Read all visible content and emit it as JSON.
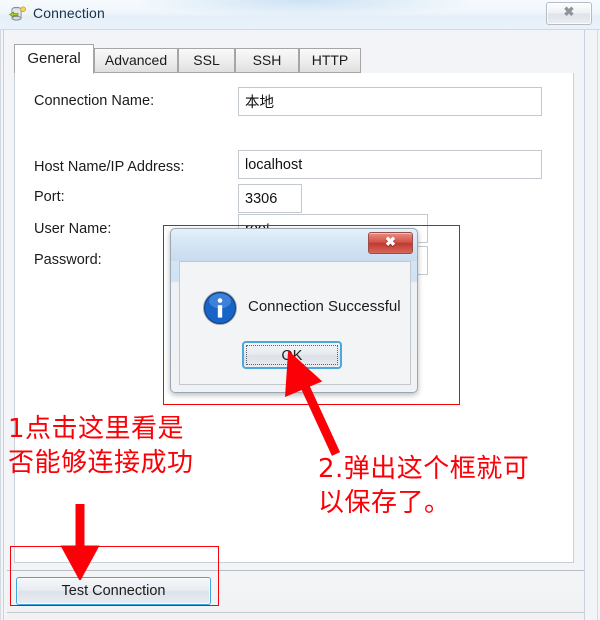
{
  "window": {
    "title": "Connection",
    "icon": "database-connection-icon",
    "close_label": "✕"
  },
  "tabs": [
    {
      "label": "General",
      "active": true
    },
    {
      "label": "Advanced",
      "active": false
    },
    {
      "label": "SSL",
      "active": false
    },
    {
      "label": "SSH",
      "active": false
    },
    {
      "label": "HTTP",
      "active": false
    }
  ],
  "form": {
    "fields": [
      {
        "label": "Connection Name:",
        "value": "本地",
        "name": "connection-name"
      },
      {
        "label": "Host Name/IP Address:",
        "value": "localhost",
        "name": "host-name"
      },
      {
        "label": "Port:",
        "value": "3306",
        "name": "port"
      },
      {
        "label": "User Name:",
        "value": "root",
        "name": "user-name"
      },
      {
        "label": "Password:",
        "value": "",
        "name": "password"
      }
    ]
  },
  "footer": {
    "test_button": "Test Connection"
  },
  "dialog": {
    "title": "",
    "message": "Connection Successful",
    "ok_label": "OK",
    "close_label": "✕",
    "icon": "info-icon"
  },
  "annotations": {
    "text_1": "1点击这里看是\n否能够连接成功",
    "text_2": "2.弹出这个框就可\n以保存了。",
    "color": "#fb0007"
  },
  "colors": {
    "accent_blue": "#3ea6dd",
    "dialog_close_red": "#c03a30",
    "info_blue": "#1763c6",
    "annotation_red": "#fb0007"
  }
}
